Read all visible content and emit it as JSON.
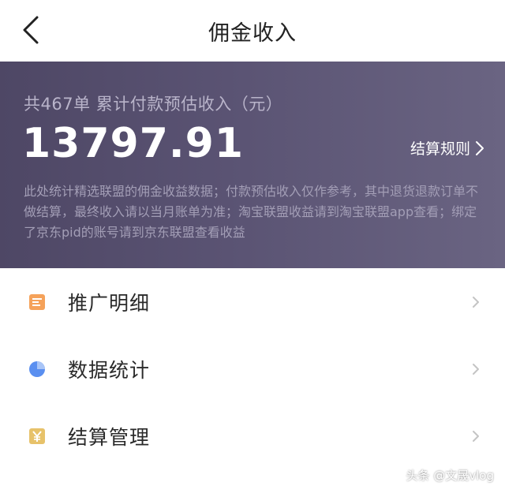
{
  "header": {
    "title": "佣金收入",
    "back_icon": "chevron-left-icon"
  },
  "summary": {
    "order_summary": "共467单 累计付款预估收入（元）",
    "amount": "13797.91",
    "rules_label": "结算规则",
    "notice": "此处统计精选联盟的佣金收益数据；付款预估收入仅作参考，其中退货退款订单不做结算，最终收入请以当月账单为准；淘宝联盟收益请到淘宝联盟app查看；绑定了京东pid的账号请到京东联盟查看收益"
  },
  "menu": {
    "items": [
      {
        "label": "推广明细",
        "icon": "document-icon",
        "icon_color": "#f5a25a"
      },
      {
        "label": "数据统计",
        "icon": "pie-chart-icon",
        "icon_color": "#5a8ff0"
      },
      {
        "label": "结算管理",
        "icon": "yen-icon",
        "icon_color": "#e7c26a"
      }
    ]
  },
  "watermark": "头条 @文晟vlog",
  "colors": {
    "banner_start": "#4e4765",
    "banner_end": "#6a6482",
    "notice_text": "#a39eb6",
    "chevron": "#c4c4c4"
  }
}
